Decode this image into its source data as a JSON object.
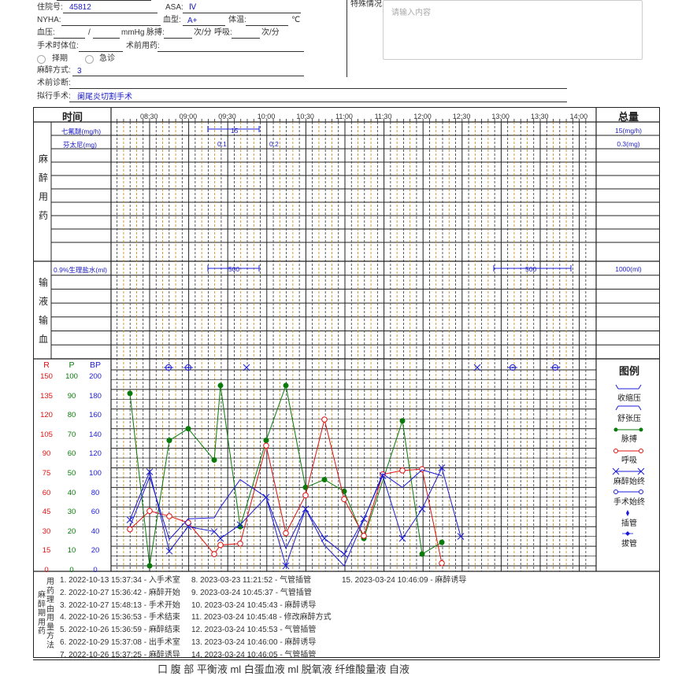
{
  "form": {
    "admission_label": "住院号:",
    "admission_value": "45812",
    "asa_label": "ASA:",
    "asa_value": "Ⅳ",
    "special_label": "特殊情况:",
    "special_placeholder": "请输入内容",
    "nyha_label": "NYHA:",
    "blood_type_label": "血型:",
    "blood_type_value": "A+",
    "temp_label": "体温:",
    "temp_unit": "℃",
    "bp_label": "血压:",
    "bp_sep": "/",
    "bp_unit": "mmHg",
    "pulse_label": "脉搏:",
    "pulse_unit": "次/分",
    "resp_label": "呼吸:",
    "resp_unit": "次/分",
    "position_label": "手术时体位:",
    "preop_drug_label": "术前用药:",
    "elective_label": "择期",
    "emergency_label": "急诊",
    "anesthesia_method_label": "麻醉方式:",
    "anesthesia_method_value": "3",
    "preop_diag_label": "术前诊断:",
    "planned_op_label": "拟行手术:",
    "planned_op_value": "阑尾炎切割手术"
  },
  "grid": {
    "time_header": "时间",
    "total_header": "总量",
    "times": [
      "08:30",
      "09:00",
      "09:30",
      "10:00",
      "10:30",
      "11:00",
      "11:30",
      "12:00",
      "12:30",
      "13:00",
      "13:30",
      "14:00"
    ],
    "anesthesia_section": [
      "麻",
      "醉",
      "用",
      "药"
    ],
    "infusion_section": [
      "输",
      "液",
      "输",
      "血"
    ],
    "drugs": [
      {
        "name": "七氟醚(mg/h)",
        "dose": "15",
        "total": "15(mg/h)"
      },
      {
        "name": "芬太尼(mg)",
        "dose1": "0.1",
        "dose2": "0.2",
        "total": "0.3(mg)"
      }
    ],
    "fluids": [
      {
        "name": "0.9%生理盐水(ml)",
        "dose1": "500",
        "dose2": "500",
        "total": "1000(ml)"
      }
    ],
    "vital_headers": {
      "r": "R",
      "p": "P",
      "bp": "BP"
    },
    "r_axis": [
      "150",
      "135",
      "120",
      "105",
      "90",
      "75",
      "60",
      "45",
      "30",
      "15",
      "0"
    ],
    "p_axis": [
      "100",
      "90",
      "80",
      "70",
      "60",
      "50",
      "40",
      "30",
      "20",
      "10",
      "0"
    ],
    "bp_axis": [
      "200",
      "180",
      "160",
      "140",
      "120",
      "100",
      "80",
      "60",
      "40",
      "20",
      "0"
    ],
    "legend_title": "图例",
    "legend": [
      "收缩压",
      "舒张压",
      "脉搏",
      "呼吸",
      "麻醉始终",
      "手术始终",
      "插管",
      "拔管"
    ],
    "colors": {
      "pulse": "#0a7a0a",
      "resp": "#e01010",
      "bp": "#1c1cd8",
      "grid_orange": "#c8860a"
    }
  },
  "events": {
    "sidebar_left": [
      "用",
      "药",
      "理",
      "由",
      "用",
      "量",
      "方",
      "法"
    ],
    "sidebar_right": [
      "麻",
      "醉",
      "期",
      "用",
      "药"
    ],
    "col1": [
      "1. 2022-10-13 15:37:34 - 入手术室",
      "2. 2022-10-27 15:36:42 - 麻醉开始",
      "3. 2022-10-27 15:48:13 - 手术开始",
      "4. 2022-10-26 15:36:53 - 手术结束",
      "5. 2022-10-26 15:36:59 - 麻醉结束",
      "6. 2022-10-29 15:37:08 - 出手术室",
      "7. 2022-10-26 15:37:25 - 麻醉诱导"
    ],
    "col2": [
      "8. 2023-03-23 11:21:52 - 气管插管",
      "9. 2023-03-24 10:45:37 - 气管插管",
      "10. 2023-03-24 10:45:43 - 麻醉诱导",
      "11. 2023-03-24 10:45:48 - 修改麻醉方式",
      "12. 2023-03-24 10:45:53 - 气管插管",
      "13. 2023-03-24 10:46:00 - 麻醉诱导",
      "14. 2023-03-24 10:46:05 - 气管插管"
    ],
    "col3": [
      "15. 2023-03-24 10:46:09 - 麻醉诱导"
    ],
    "bottom_cut": "口 腹 部     平衡液     ml 白蛋血液     ml 脱氧液     纤维酸量液     自液"
  },
  "chart_data": {
    "type": "line",
    "x_labels": [
      "08:30",
      "09:00",
      "09:30",
      "10:00",
      "10:30",
      "11:00",
      "11:30",
      "12:00",
      "12:30",
      "13:00",
      "13:30",
      "14:00"
    ],
    "series": [
      {
        "name": "脉搏",
        "axis": "P",
        "values": [
          88,
          0,
          64,
          70,
          54,
          92,
          20,
          64,
          100,
          40,
          44,
          38,
          14,
          74,
          6,
          12
        ]
      },
      {
        "name": "呼吸",
        "axis": "R",
        "values": [
          28,
          42,
          38,
          33,
          9,
          16,
          17,
          92,
          25,
          54,
          112,
          51,
          23,
          70,
          73,
          74,
          2
        ]
      },
      {
        "name": "收缩压",
        "axis": "BP",
        "values": [
          40,
          91,
          27,
          48,
          49,
          55,
          38,
          88,
          18,
          58,
          21,
          72,
          47,
          94,
          80,
          98,
          92
        ]
      },
      {
        "name": "舒张压",
        "axis": "BP",
        "values": [
          47,
          23,
          15,
          40,
          35,
          28,
          42,
          33,
          0,
          58,
          28,
          12,
          48,
          72,
          40,
          60
        ]
      }
    ]
  }
}
